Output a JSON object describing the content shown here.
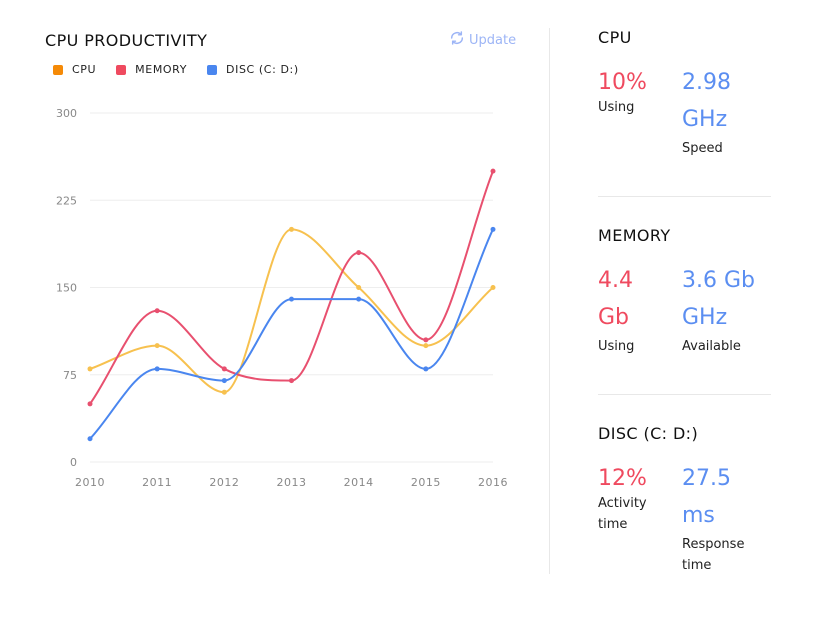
{
  "header": {
    "title": "CPU PRODUCTIVITY",
    "update_label": "Update"
  },
  "colors": {
    "cpu": "#f58a07",
    "memory": "#ef4a5f",
    "disc": "#4a86ef",
    "cpu_line": "#f7c14f",
    "memory_line": "#e8506f",
    "disc_line": "#4a86ef"
  },
  "legend": [
    {
      "label": "CPU",
      "color": "#f58a07"
    },
    {
      "label": "MEMORY",
      "color": "#ef4a5f"
    },
    {
      "label": "DISC (C: D:)",
      "color": "#4a86ef"
    }
  ],
  "chart_data": {
    "type": "line",
    "x": [
      "2010",
      "2011",
      "2012",
      "2013",
      "2014",
      "2015",
      "2016"
    ],
    "ylim": [
      0,
      300
    ],
    "yticks": [
      0,
      75,
      150,
      225,
      300
    ],
    "grid": true,
    "legend_position": "top-left",
    "series": [
      {
        "name": "CPU",
        "color": "#f7c14f",
        "values": [
          80,
          100,
          60,
          200,
          150,
          100,
          150
        ]
      },
      {
        "name": "MEMORY",
        "color": "#e8506f",
        "values": [
          50,
          130,
          80,
          70,
          180,
          105,
          250
        ]
      },
      {
        "name": "DISC (C: D:)",
        "color": "#4a86ef",
        "values": [
          20,
          80,
          70,
          140,
          140,
          80,
          200
        ]
      }
    ]
  },
  "stats": {
    "cpu": {
      "title": "CPU",
      "left": {
        "value": "10%",
        "label": "Using"
      },
      "right": {
        "value_line1": "2.98",
        "value_line2": "GHz",
        "label": "Speed"
      }
    },
    "memory": {
      "title": "MEMORY",
      "left": {
        "value_line1": "4.4",
        "value_line2": "Gb",
        "label": "Using"
      },
      "right": {
        "value_line1": "3.6 Gb",
        "value_line2": "GHz",
        "label": "Available"
      }
    },
    "disc": {
      "title": "DISC (C: D:)",
      "left": {
        "value": "12%",
        "label_line1": "Activity",
        "label_line2": "time"
      },
      "right": {
        "value_line1": "27.5",
        "value_line2": "ms",
        "label_line1": "Response",
        "label_line2": "time"
      }
    }
  }
}
